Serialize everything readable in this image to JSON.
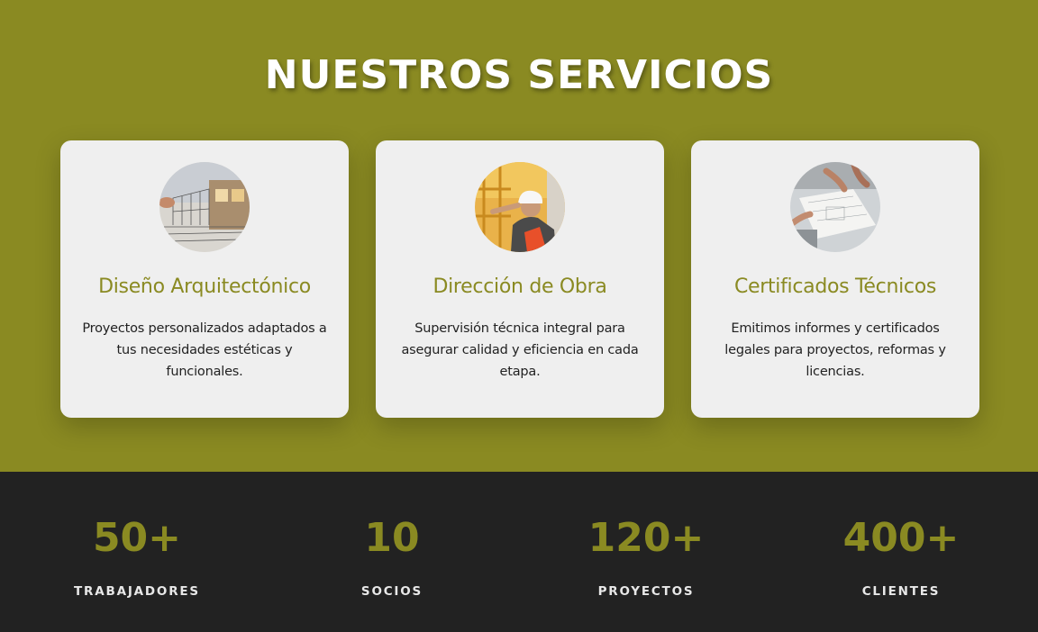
{
  "colors": {
    "accent": "#8a8a22",
    "card_bg": "#efefef",
    "dark_bg": "#222222",
    "title_text": "#ffffff"
  },
  "services": {
    "title": "NUESTROS SERVICIOS",
    "cards": [
      {
        "image": "architecture-sketch-image",
        "title": "Diseño Arquitectónico",
        "description": "Proyectos personalizados adaptados a tus necesidades estéticas y funcionales."
      },
      {
        "image": "construction-worker-image",
        "title": "Dirección de Obra",
        "description": "Supervisión técnica integral para asegurar calidad y eficiencia en cada etapa."
      },
      {
        "image": "blueprint-meeting-image",
        "title": "Certificados Técnicos",
        "description": "Emitimos informes y certificados legales para proyectos, reformas y licencias."
      }
    ]
  },
  "stats": [
    {
      "value": "50+",
      "label": "TRABAJADORES"
    },
    {
      "value": "10",
      "label": "SOCIOS"
    },
    {
      "value": "120+",
      "label": "PROYECTOS"
    },
    {
      "value": "400+",
      "label": "CLIENTES"
    }
  ]
}
